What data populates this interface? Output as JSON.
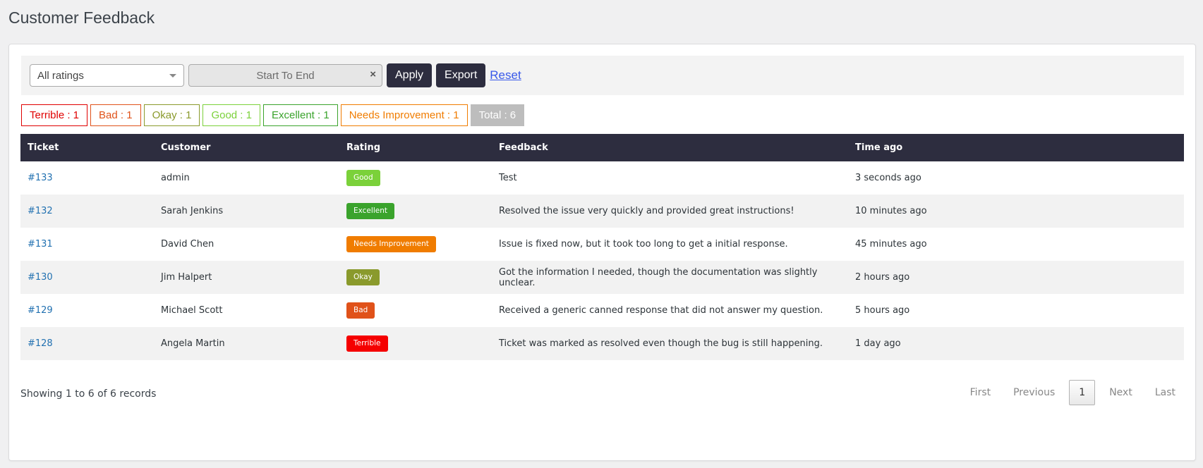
{
  "page": {
    "title": "Customer Feedback"
  },
  "filters": {
    "rating_select": "All ratings",
    "date_range": "Start To End",
    "clear": "×",
    "apply": "Apply",
    "export": "Export",
    "reset": "Reset"
  },
  "summary": [
    {
      "label": "Terrible : 1",
      "color": "#e00000"
    },
    {
      "label": "Bad : 1",
      "color": "#e0521a"
    },
    {
      "label": "Okay : 1",
      "color": "#8a9a2c"
    },
    {
      "label": "Good : 1",
      "color": "#7bd13a"
    },
    {
      "label": "Excellent : 1",
      "color": "#3aa32c"
    },
    {
      "label": "Needs Improvement : 1",
      "color": "#f07c00"
    },
    {
      "label": "Total : 6",
      "color": "#bdbdbd"
    }
  ],
  "table": {
    "headers": [
      "Ticket",
      "Customer",
      "Rating",
      "Feedback",
      "Time ago"
    ],
    "rows": [
      {
        "ticket": "#133",
        "customer": "admin",
        "rating": "Good",
        "rating_color": "#7bd13a",
        "feedback": "Test",
        "time": "3 seconds ago"
      },
      {
        "ticket": "#132",
        "customer": "Sarah Jenkins",
        "rating": "Excellent",
        "rating_color": "#3aa32c",
        "feedback": "Resolved the issue very quickly and provided great instructions!",
        "time": "10 minutes ago"
      },
      {
        "ticket": "#131",
        "customer": "David Chen",
        "rating": "Needs Improvement",
        "rating_color": "#f07c00",
        "feedback": "Issue is fixed now, but it took too long to get a initial response.",
        "time": "45 minutes ago"
      },
      {
        "ticket": "#130",
        "customer": "Jim Halpert",
        "rating": "Okay",
        "rating_color": "#8a9a2c",
        "feedback": "Got the information I needed, though the documentation was slightly unclear.",
        "time": "2 hours ago"
      },
      {
        "ticket": "#129",
        "customer": "Michael Scott",
        "rating": "Bad",
        "rating_color": "#e0521a",
        "feedback": "Received a generic canned response that did not answer my question.",
        "time": "5 hours ago"
      },
      {
        "ticket": "#128",
        "customer": "Angela Martin",
        "rating": "Terrible",
        "rating_color": "#f50000",
        "feedback": "Ticket was marked as resolved even though the bug is still happening.",
        "time": "1 day ago"
      }
    ]
  },
  "footer": {
    "showing": "Showing 1 to 6 of 6 records",
    "pagination": {
      "first": "First",
      "previous": "Previous",
      "current": "1",
      "next": "Next",
      "last": "Last"
    }
  }
}
